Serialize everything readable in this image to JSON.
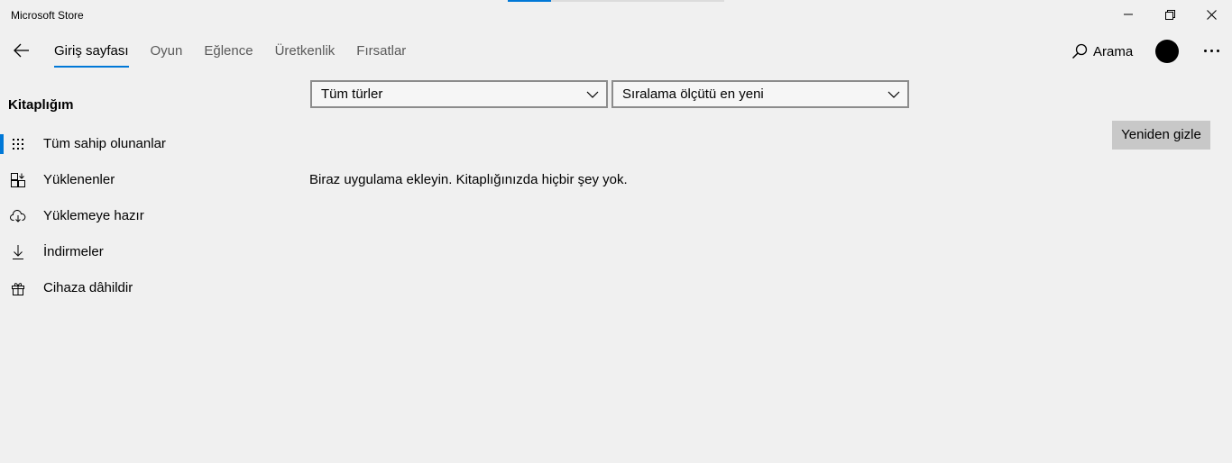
{
  "window": {
    "title": "Microsoft Store",
    "loading_progress": 0.2,
    "controls": {
      "minimize": "minimize-icon",
      "maximize": "restore-icon",
      "close": "close-icon"
    }
  },
  "nav": {
    "back_icon": "back-arrow-icon",
    "tabs": [
      {
        "label": "Giriş sayfası",
        "active": true
      },
      {
        "label": "Oyun",
        "active": false
      },
      {
        "label": "Eğlence",
        "active": false
      },
      {
        "label": "Üretkenlik",
        "active": false
      },
      {
        "label": "Fırsatlar",
        "active": false
      }
    ],
    "search_label": "Arama",
    "search_icon": "search-icon",
    "more_icon": "more-icon"
  },
  "sidebar": {
    "title": "Kitaplığım",
    "items": [
      {
        "label": "Tüm sahip olunanlar",
        "icon": "grid-icon",
        "selected": true
      },
      {
        "label": "Yüklenenler",
        "icon": "installed-icon",
        "selected": false
      },
      {
        "label": "Yüklemeye hazır",
        "icon": "cloud-download-icon",
        "selected": false
      },
      {
        "label": "İndirmeler",
        "icon": "download-icon",
        "selected": false
      },
      {
        "label": "Cihaza dâhildir",
        "icon": "gift-icon",
        "selected": false
      }
    ]
  },
  "filters": {
    "type_selected": "Tüm türler",
    "sort_selected": "Sıralama ölçütü en yeni"
  },
  "main": {
    "hide_button": "Yeniden gizle",
    "empty_message": "Biraz uygulama ekleyin. Kitaplığınızda hiçbir şey yok."
  },
  "colors": {
    "accent": "#0078d7",
    "background": "#f0f0f0",
    "button_bg": "#c8c8c8"
  }
}
